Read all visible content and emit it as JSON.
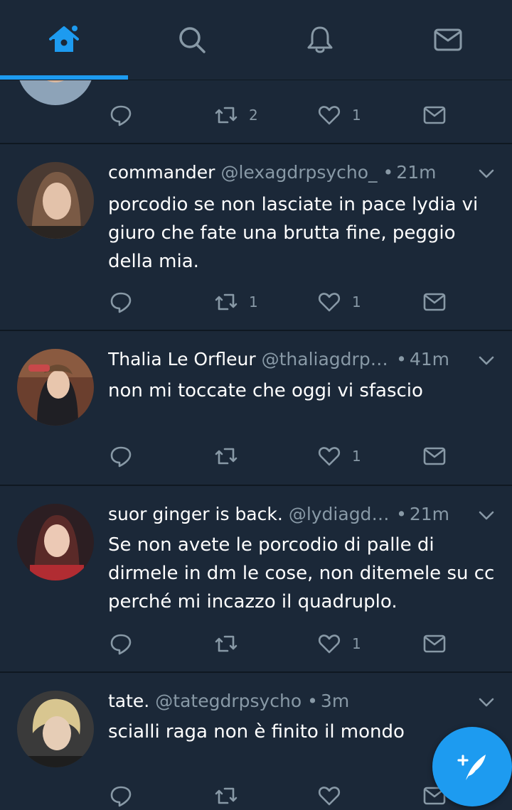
{
  "nav": {
    "tabs": [
      {
        "icon": "home-icon",
        "active": true
      },
      {
        "icon": "search-icon",
        "active": false
      },
      {
        "icon": "bell-icon",
        "active": false
      },
      {
        "icon": "mail-icon",
        "active": false
      }
    ],
    "accent": "#1d9bf0"
  },
  "prev_tweet_actions": {
    "retweets": "2",
    "likes": "1"
  },
  "tweets": [
    {
      "name": "commander",
      "handle": "@lexagdrpsycho_",
      "time": "21m",
      "text": "porcodio se non lasciate in pace lydia vi giuro che fate una brutta fine, peggio della mia.",
      "retweets": "1",
      "likes": "1"
    },
    {
      "name": "Thalia Le Orfleur",
      "handle": "@thaliagdrps...",
      "time": "41m",
      "text": "non mi toccate che oggi vi sfascio",
      "retweets": "",
      "likes": "1"
    },
    {
      "name": "suor ginger is back.",
      "handle": "@lydiagdrP...",
      "time": "21m",
      "text": "Se non avete le porcodio di palle di dirmele in dm le cose, non ditemele su cc perché mi incazzo il quadruplo.",
      "retweets": "",
      "likes": "1"
    },
    {
      "name": "tate.",
      "handle": "@tategdrpsycho",
      "time": "3m",
      "text": "scialli raga non è finito il mondo",
      "retweets": "",
      "likes": ""
    }
  ],
  "dot": "•",
  "colors": {
    "background": "#1b2838",
    "secondary_text": "#8899a6",
    "separator": "#0f1821"
  }
}
